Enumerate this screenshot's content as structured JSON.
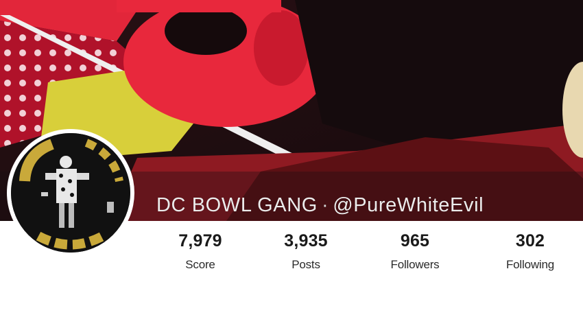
{
  "profile": {
    "display_name": "DC BOWL GANG",
    "separator": "·",
    "handle": "@PureWhiteEvil"
  },
  "avatar": {
    "icon": "avatar-image"
  },
  "banner": {
    "icon": "banner-image"
  },
  "stats": {
    "score": {
      "value": "7,979",
      "label": "Score"
    },
    "posts": {
      "value": "3,935",
      "label": "Posts"
    },
    "followers": {
      "value": "965",
      "label": "Followers"
    },
    "following": {
      "value": "302",
      "label": "Following"
    }
  },
  "colors": {
    "banner_red": "#e8283c",
    "banner_dark": "#1a0d10",
    "banner_yellow": "#d8cf3a",
    "text_dark": "#1a1a1a",
    "name_text": "#ececec"
  }
}
